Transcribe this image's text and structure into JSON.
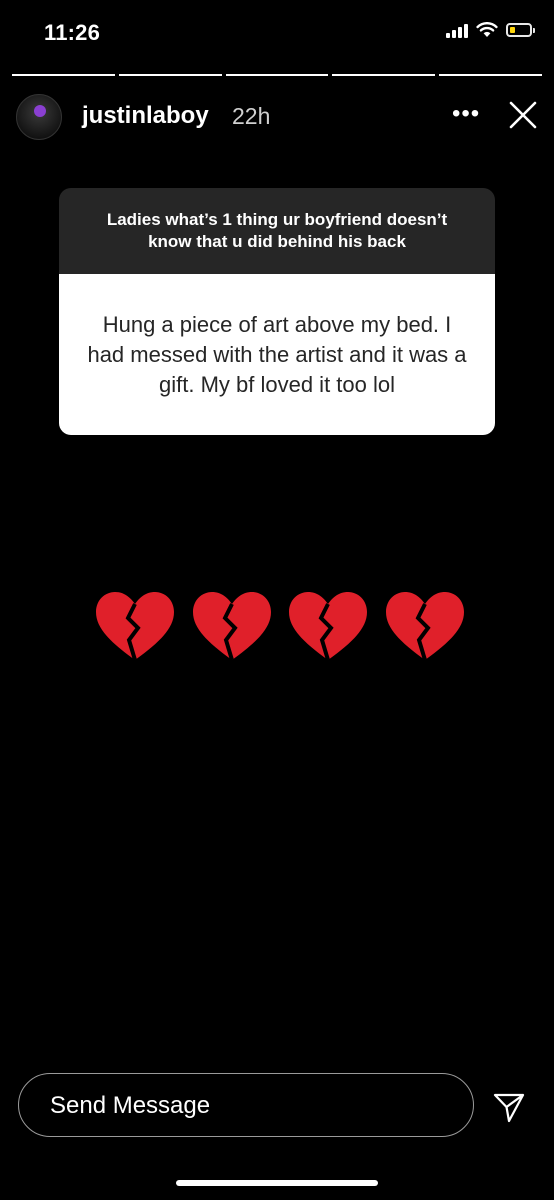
{
  "status_bar": {
    "time": "11:26",
    "battery_level": 0.4,
    "battery_color": "#ffd60a"
  },
  "story": {
    "username": "justinlaboy",
    "time_ago": "22h",
    "segments_total": 5,
    "segments_viewed": 5
  },
  "question_box": {
    "question": "Ladies what’s 1 thing ur boyfriend doesn’t know that u did behind his back",
    "answer": "Hung a piece of art above my bed. I had messed with the artist and it was a gift. My bf loved it too lol"
  },
  "emojis": {
    "icon": "broken-heart",
    "count": 4,
    "color": "#e0202a"
  },
  "reply": {
    "placeholder": "Send Message"
  }
}
